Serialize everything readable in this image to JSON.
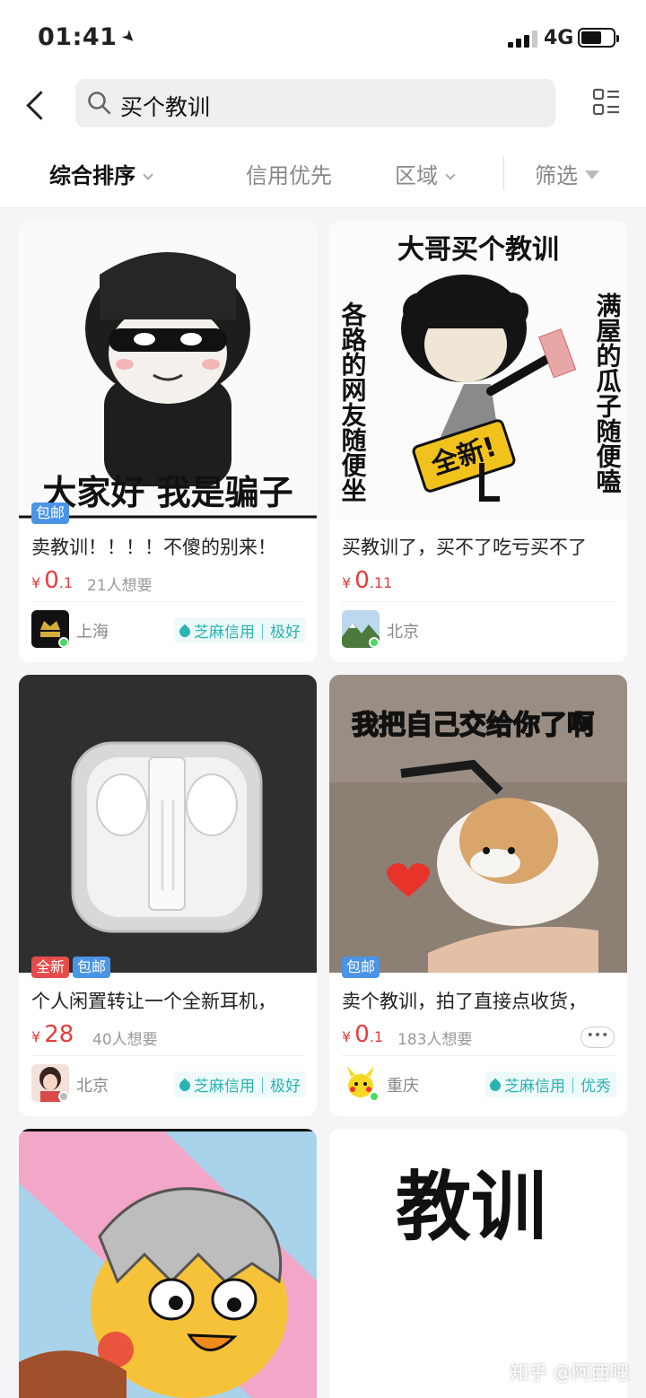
{
  "status_bar": {
    "time": "01:41",
    "network": "4G"
  },
  "search": {
    "query": "买个教训"
  },
  "filters": {
    "sort": "综合排序",
    "credit": "信用优先",
    "region": "区域",
    "filter": "筛选"
  },
  "items": [
    {
      "image_text": "大家好 我是骗子",
      "tags": [
        "包邮"
      ],
      "title": "卖教训！！！！不傻的别来！",
      "price_int": "0",
      "price_dec": ".1",
      "wants": "21人想要",
      "city": "上海",
      "credit": "芝麻信用｜极好"
    },
    {
      "image_text": "大哥买个教训",
      "image_left_text": "各路的网友随便坐",
      "image_right_text": "满屋的瓜子随便嗑",
      "image_badge": "全新!",
      "tags": [],
      "title": "买教训了，买不了吃亏买不了",
      "price_int": "0",
      "price_dec": ".11",
      "wants": "",
      "city": "北京",
      "credit": ""
    },
    {
      "image_text": "",
      "tags": [
        "全新",
        "包邮"
      ],
      "title": "个人闲置转让一个全新耳机，",
      "price_int": "28",
      "price_dec": "",
      "wants": "40人想要",
      "city": "北京",
      "credit": "芝麻信用｜极好"
    },
    {
      "image_text": "我把自己交给你了啊",
      "tags": [
        "包邮"
      ],
      "title": "卖个教训，拍了直接点收货，",
      "price_int": "0",
      "price_dec": ".1",
      "wants": "183人想要",
      "city": "重庆",
      "credit": "芝麻信用｜优秀"
    },
    {
      "image_text": ""
    },
    {
      "image_text": "教训"
    }
  ],
  "watermark": "知乎 @阿西吧"
}
